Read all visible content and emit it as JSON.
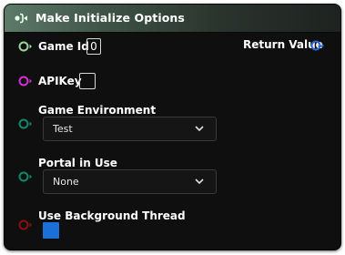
{
  "node": {
    "title": "Make Initialize Options",
    "header_icon": "function-icon",
    "pins": {
      "game_id": {
        "label": "Game Id",
        "value": "0",
        "color": "#9ad69a"
      },
      "api_key": {
        "label": "APIKey",
        "value": "",
        "color": "#d62fd6"
      },
      "game_environment": {
        "label": "Game Environment",
        "selected": "Test",
        "color": "#0e8a6a"
      },
      "portal_in_use": {
        "label": "Portal in Use",
        "selected": "None",
        "color": "#0e8a6a"
      },
      "use_background_thread": {
        "label": "Use Background Thread",
        "checked": true,
        "color": "#8c1010"
      },
      "return_value": {
        "label": "Return Value",
        "color": "#2a6ad8"
      }
    }
  }
}
